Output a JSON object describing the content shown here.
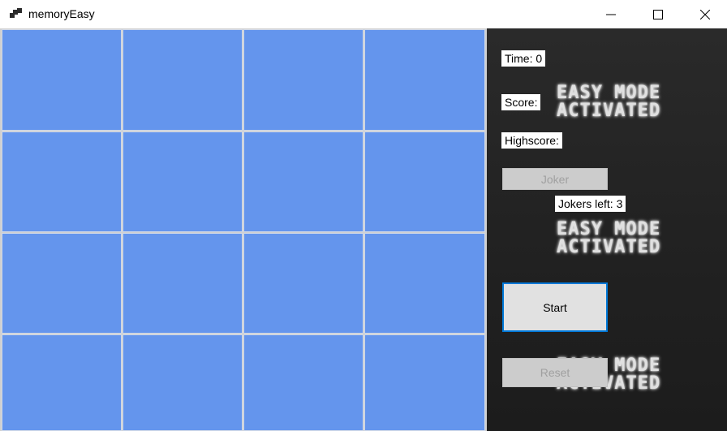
{
  "window": {
    "title": "memoryEasy"
  },
  "board": {
    "rows": 4,
    "columns": 4,
    "card_color": "#6495ed",
    "state": "all cards face down"
  },
  "sidebar": {
    "time_label": "Time: 0",
    "score_label": "Score:",
    "highscore_label": "Highscore:",
    "joker_button": "Joker",
    "jokers_left_label": "Jokers left: 3",
    "start_button": "Start",
    "reset_button": "Reset",
    "banner": {
      "line1": "EASY MODE",
      "line2": "ACTIVATED"
    }
  }
}
